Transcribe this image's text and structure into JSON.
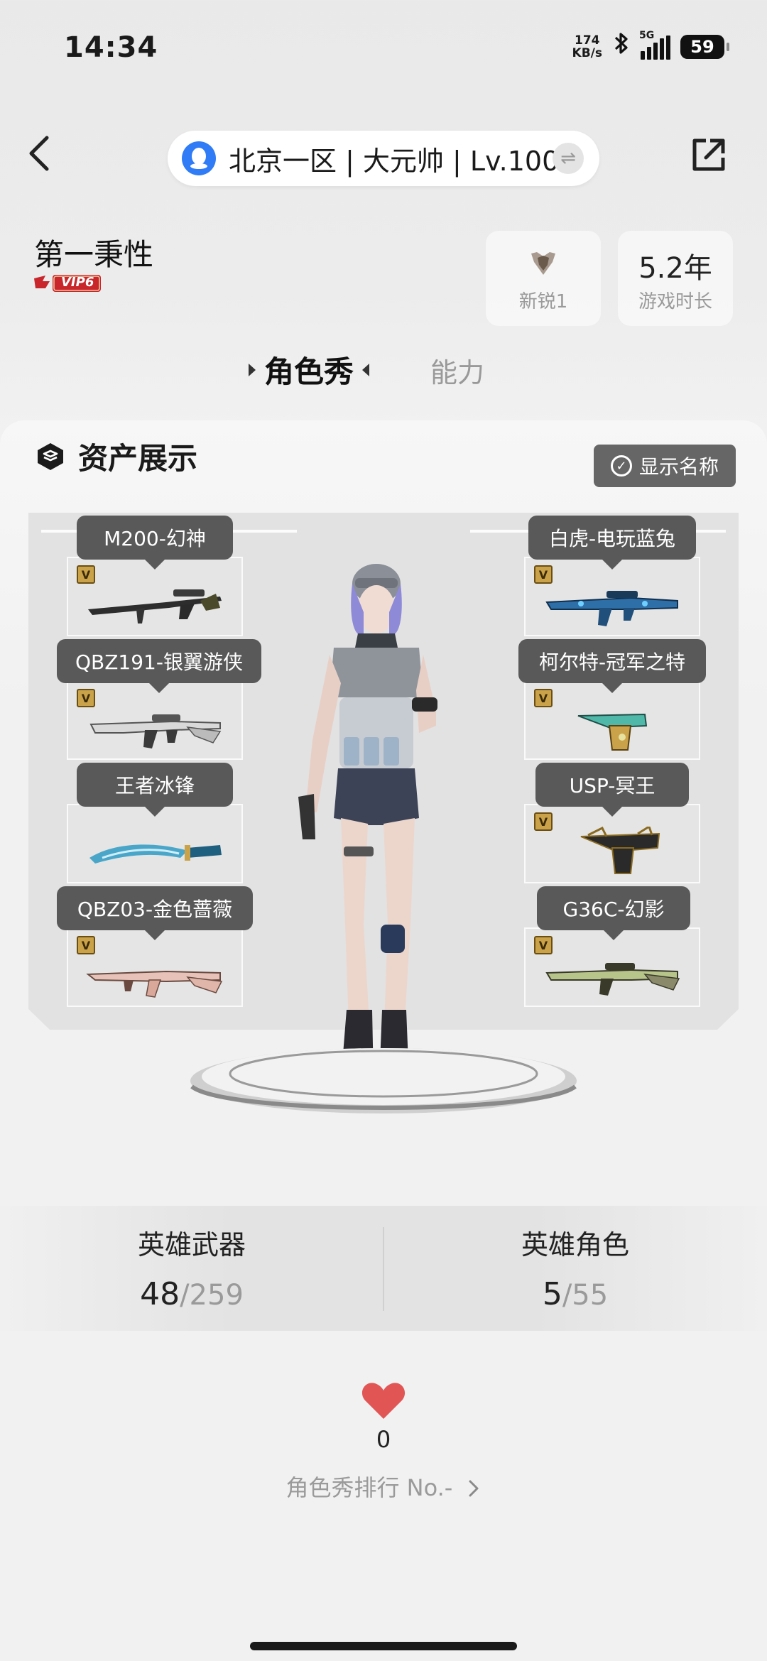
{
  "status_bar": {
    "time": "14:34",
    "net_speed": "174",
    "net_unit": "KB/s",
    "network": "5G",
    "battery": "59"
  },
  "header": {
    "server": "北京一区 | 大元帅 | Lv.100"
  },
  "player": {
    "name": "第一秉性",
    "vip": "VIP6",
    "rank_label": "新锐1",
    "playtime_value": "5.2年",
    "playtime_label": "游戏时长"
  },
  "tabs": [
    {
      "label": "角色秀",
      "active": true
    },
    {
      "label": "能力",
      "active": false
    }
  ],
  "assets": {
    "title": "资产展示",
    "show_names_label": "显示名称",
    "weapons_left": [
      {
        "name": "M200-幻神",
        "badge": "V"
      },
      {
        "name": "QBZ191-银翼游侠",
        "badge": "V"
      },
      {
        "name": "王者冰锋",
        "badge": ""
      },
      {
        "name": "QBZ03-金色蔷薇",
        "badge": "V"
      }
    ],
    "weapons_right": [
      {
        "name": "白虎-电玩蓝兔",
        "badge": "V"
      },
      {
        "name": "柯尔特-冠军之特",
        "badge": "V"
      },
      {
        "name": "USP-冥王",
        "badge": "V"
      },
      {
        "name": "G36C-幻影",
        "badge": "V"
      }
    ]
  },
  "counts": {
    "weapons_label": "英雄武器",
    "weapons_owned": "48",
    "weapons_total": "/259",
    "roles_label": "英雄角色",
    "roles_owned": "5",
    "roles_total": "/55"
  },
  "likes": "0",
  "ranking_text": "角色秀排行 No.-",
  "colors": {
    "heart": "#e25555",
    "qq_blue": "#2f7cf6",
    "label_bg": "#595959",
    "vip_red": "#c8262b"
  }
}
